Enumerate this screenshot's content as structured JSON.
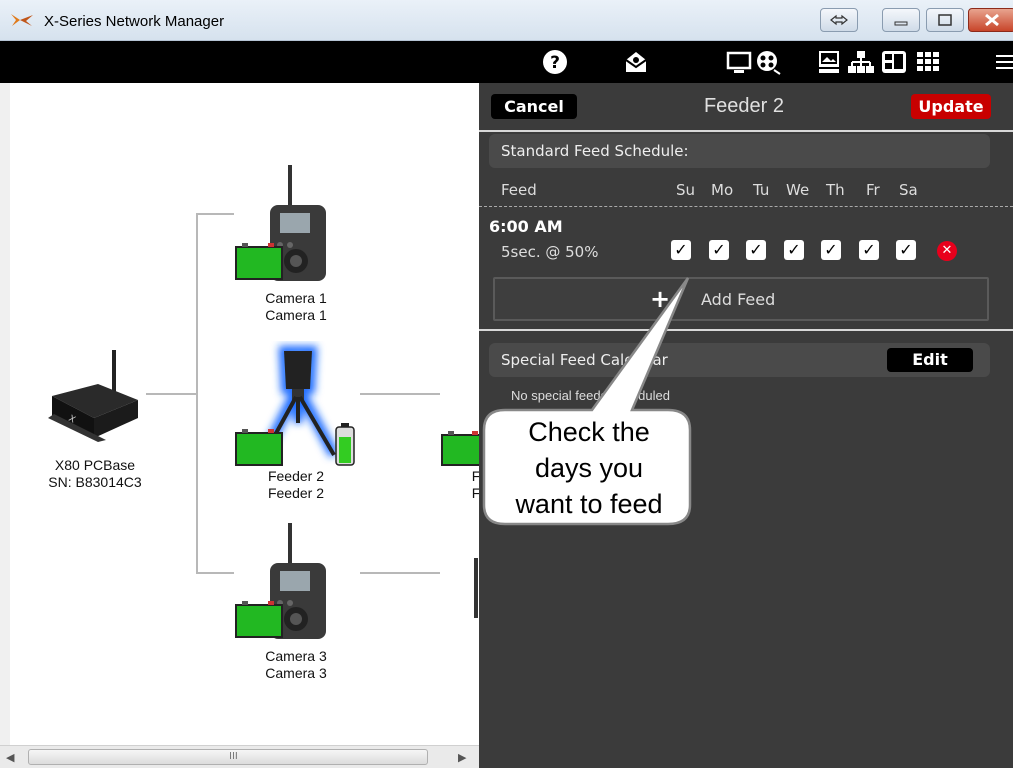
{
  "window": {
    "title": "X-Series Network Manager"
  },
  "devices": {
    "base": {
      "line1": "X80 PCBase",
      "line2": "SN: B83014C3"
    },
    "camera1": {
      "line1": "Camera 1",
      "line2": "Camera 1"
    },
    "feeder2": {
      "line1": "Feeder 2",
      "line2": "Feeder 2"
    },
    "camera3": {
      "line1": "Camera 3",
      "line2": "Camera 3"
    },
    "partial_right": {
      "line1": "F",
      "line2": "F"
    }
  },
  "panel": {
    "cancel_label": "Cancel",
    "title": "Feeder 2",
    "update_label": "Update",
    "standard_header": "Standard Feed Schedule:",
    "feed_column": "Feed",
    "days": [
      "Su",
      "Mo",
      "Tu",
      "We",
      "Th",
      "Fr",
      "Sa"
    ],
    "feed_time": "6:00 AM",
    "feed_desc": "5sec. @ 50%",
    "checks": [
      true,
      true,
      true,
      true,
      true,
      true,
      true
    ],
    "add_feed_label": "Add Feed",
    "special_header": "Special Feed Calendar",
    "edit_label": "Edit",
    "no_special": "No special feeds scheduled"
  },
  "callout": {
    "line1": "Check the",
    "line2": "days you",
    "line3": "want to feed"
  },
  "scrollbar": {
    "grip": "III"
  },
  "icons": [
    "help-icon",
    "mail-icon",
    "monitor-icon",
    "film-reel-icon",
    "image-icon",
    "network-icon",
    "layout-icon",
    "grid-icon",
    "menu-icon"
  ],
  "colors": {
    "panel": "#3b3b3b",
    "update": "#c80000",
    "toolbar": "#000000",
    "battery": "#22c122"
  }
}
